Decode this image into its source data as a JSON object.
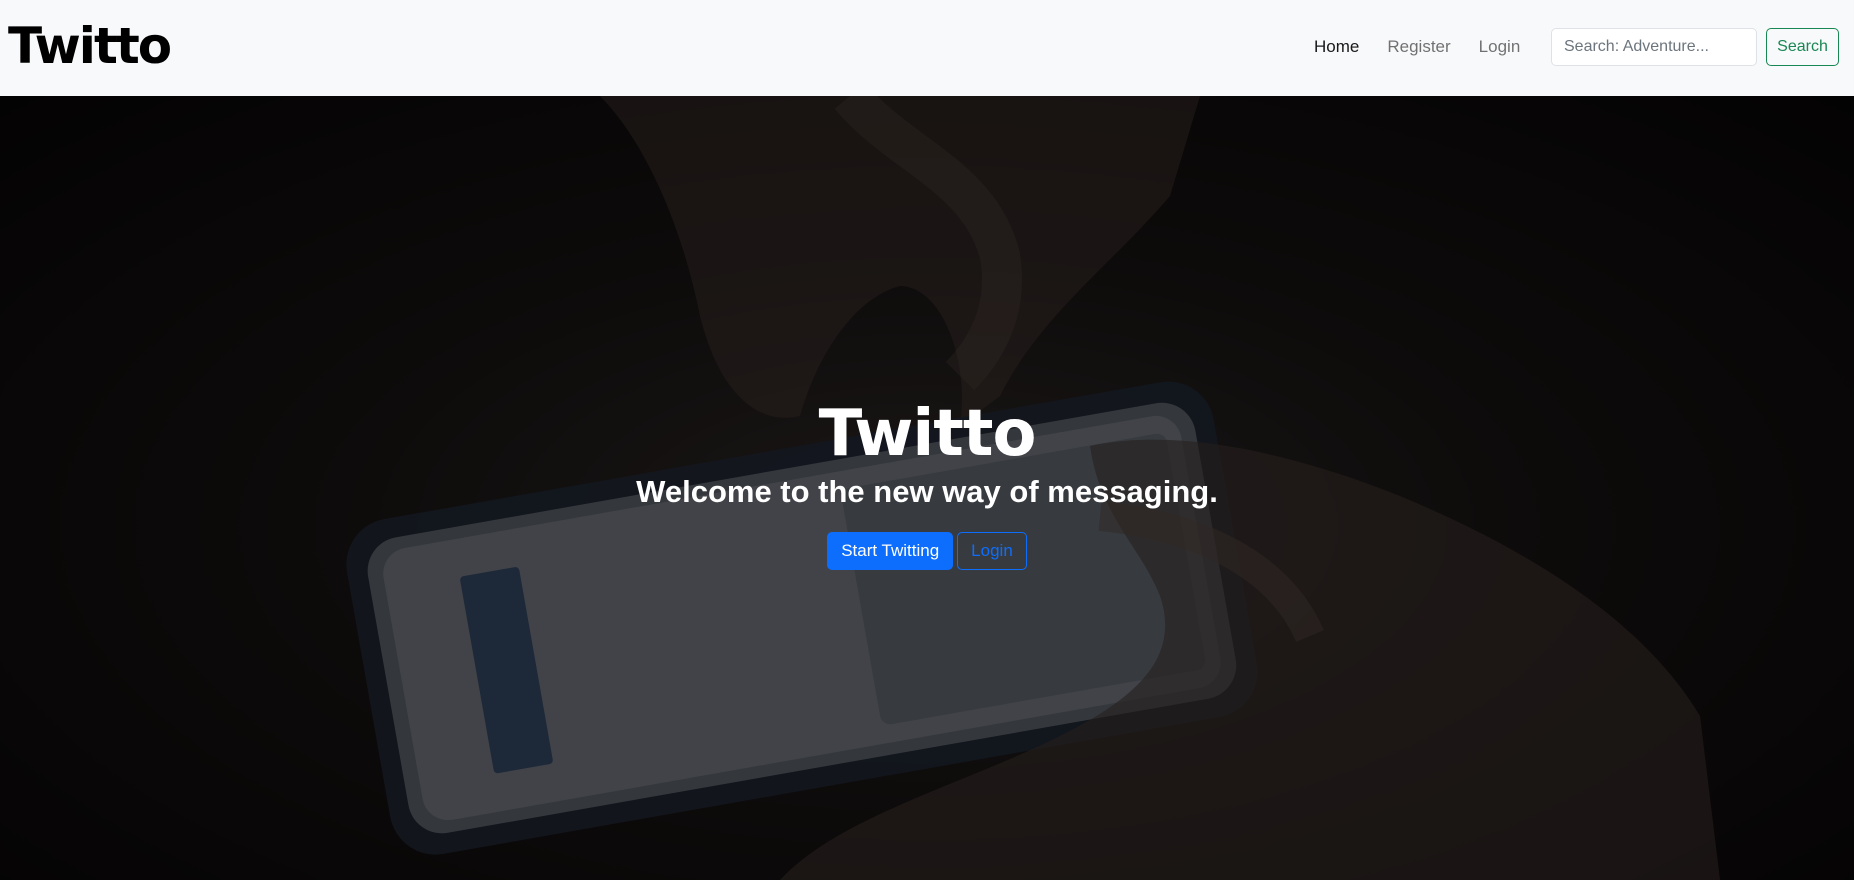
{
  "navbar": {
    "brand": "Twitto",
    "links": [
      {
        "label": "Home",
        "active": true
      },
      {
        "label": "Register",
        "active": false
      },
      {
        "label": "Login",
        "active": false
      }
    ],
    "search": {
      "placeholder": "Search: Adventure...",
      "value": "",
      "button_label": "Search"
    }
  },
  "hero": {
    "title": "Twitto",
    "subtitle": "Welcome to the new way of messaging.",
    "primary_button": "Start Twitting",
    "secondary_button": "Login"
  },
  "colors": {
    "navbar_bg": "#f8f9fa",
    "primary": "#0d6efd",
    "success": "#198754"
  }
}
